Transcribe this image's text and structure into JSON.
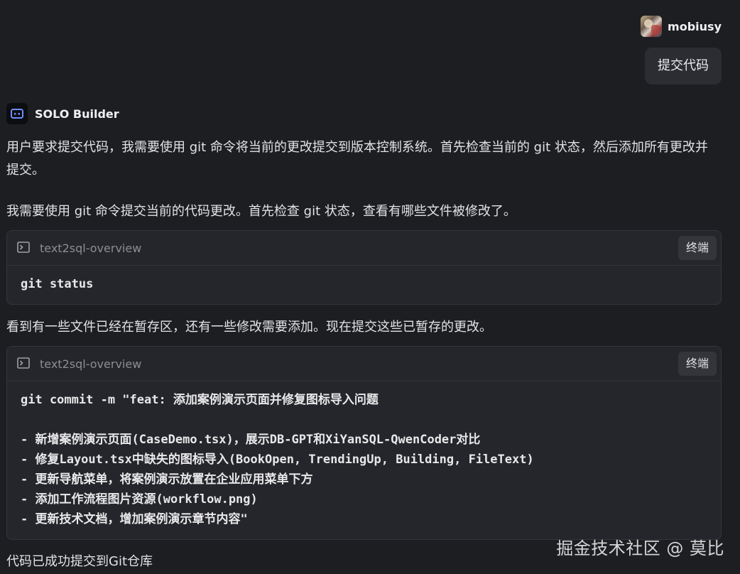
{
  "user": {
    "name": "mobiusy",
    "message": "提交代码"
  },
  "assistant": {
    "name": "SOLO Builder",
    "paragraphs": [
      "用户要求提交代码，我需要使用 git 命令将当前的更改提交到版本控制系统。首先检查当前的 git 状态，然后添加所有更改并提交。",
      "我需要使用 git 命令提交当前的代码更改。首先检查 git 状态，查看有哪些文件被修改了。",
      "看到有一些文件已经在暂存区，还有一些修改需要添加。现在提交这些已暂存的更改。",
      "代码已成功提交到Git仓库"
    ],
    "terminals": [
      {
        "title": "text2sql-overview",
        "button": "终端",
        "command": "git status"
      },
      {
        "title": "text2sql-overview",
        "button": "终端",
        "command": "git commit -m \"feat: 添加案例演示页面并修复图标导入问题\n\n- 新增案例演示页面(CaseDemo.tsx)，展示DB-GPT和XiYanSQL-QwenCoder对比\n- 修复Layout.tsx中缺失的图标导入(BookOpen, TrendingUp, Building, FileText)\n- 更新导航菜单，将案例演示放置在企业应用菜单下方\n- 添加工作流程图片资源(workflow.png)\n- 更新技术文档，增加案例演示章节内容\""
      }
    ]
  },
  "watermark": "掘金技术社区 @ 莫比",
  "icons": {
    "bot": "bot-icon",
    "terminal": "terminal-icon",
    "avatar": "avatar"
  },
  "colors": {
    "background": "#1d1e22",
    "bubble": "#2c2d33",
    "terminal_bg": "#25262b",
    "terminal_title": "#8c8d93",
    "accent_icon": "#6d8cff"
  }
}
